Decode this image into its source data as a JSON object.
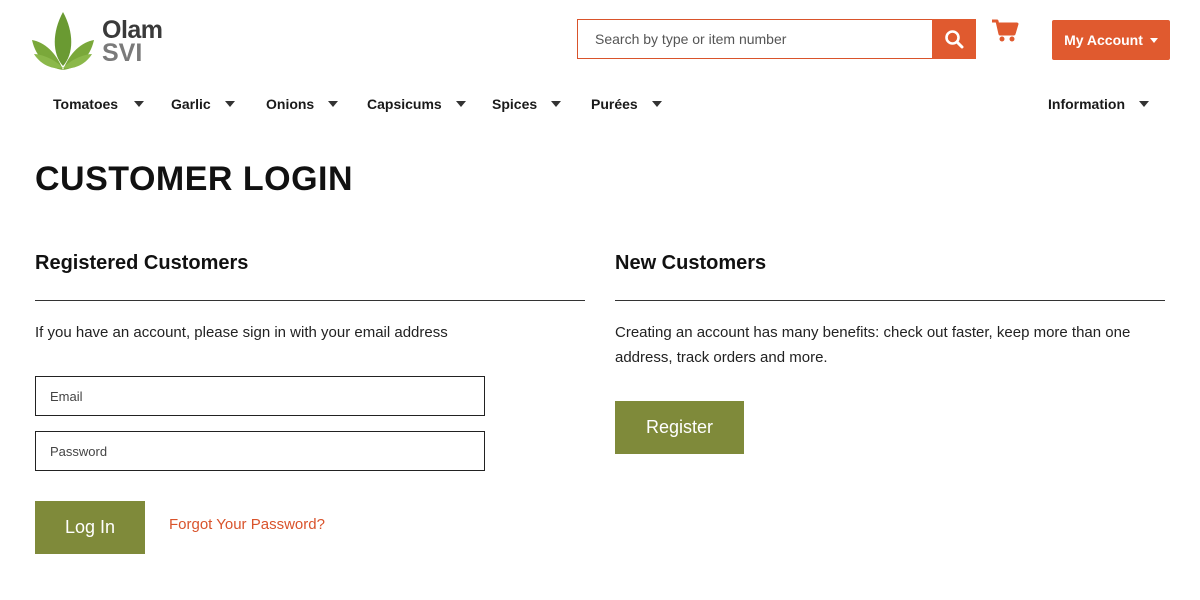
{
  "brand": {
    "name_line1": "Olam",
    "name_line2": "SVI"
  },
  "colors": {
    "accent": "#e05a2f",
    "olive": "#7f8a3a",
    "logo_green": "#6fa63a"
  },
  "header": {
    "search_placeholder": "Search by type or item number",
    "search_icon": "search-icon",
    "cart_icon": "shopping-cart-icon",
    "account_label": "My Account"
  },
  "nav": {
    "items": [
      {
        "label": "Tomatoes"
      },
      {
        "label": "Garlic"
      },
      {
        "label": "Onions"
      },
      {
        "label": "Capsicums"
      },
      {
        "label": "Spices"
      },
      {
        "label": "Purées"
      },
      {
        "label": "Information"
      }
    ]
  },
  "page": {
    "title": "CUSTOMER LOGIN"
  },
  "registered": {
    "title": "Registered Customers",
    "intro": "If you have an account, please sign in with your email address",
    "email_placeholder": "Email",
    "password_placeholder": "Password",
    "login_label": "Log In",
    "forgot_label": "Forgot Your Password?"
  },
  "new_customers": {
    "title": "New Customers",
    "intro": "Creating an account has many benefits: check out faster, keep more than one address, track orders and more.",
    "register_label": "Register"
  }
}
